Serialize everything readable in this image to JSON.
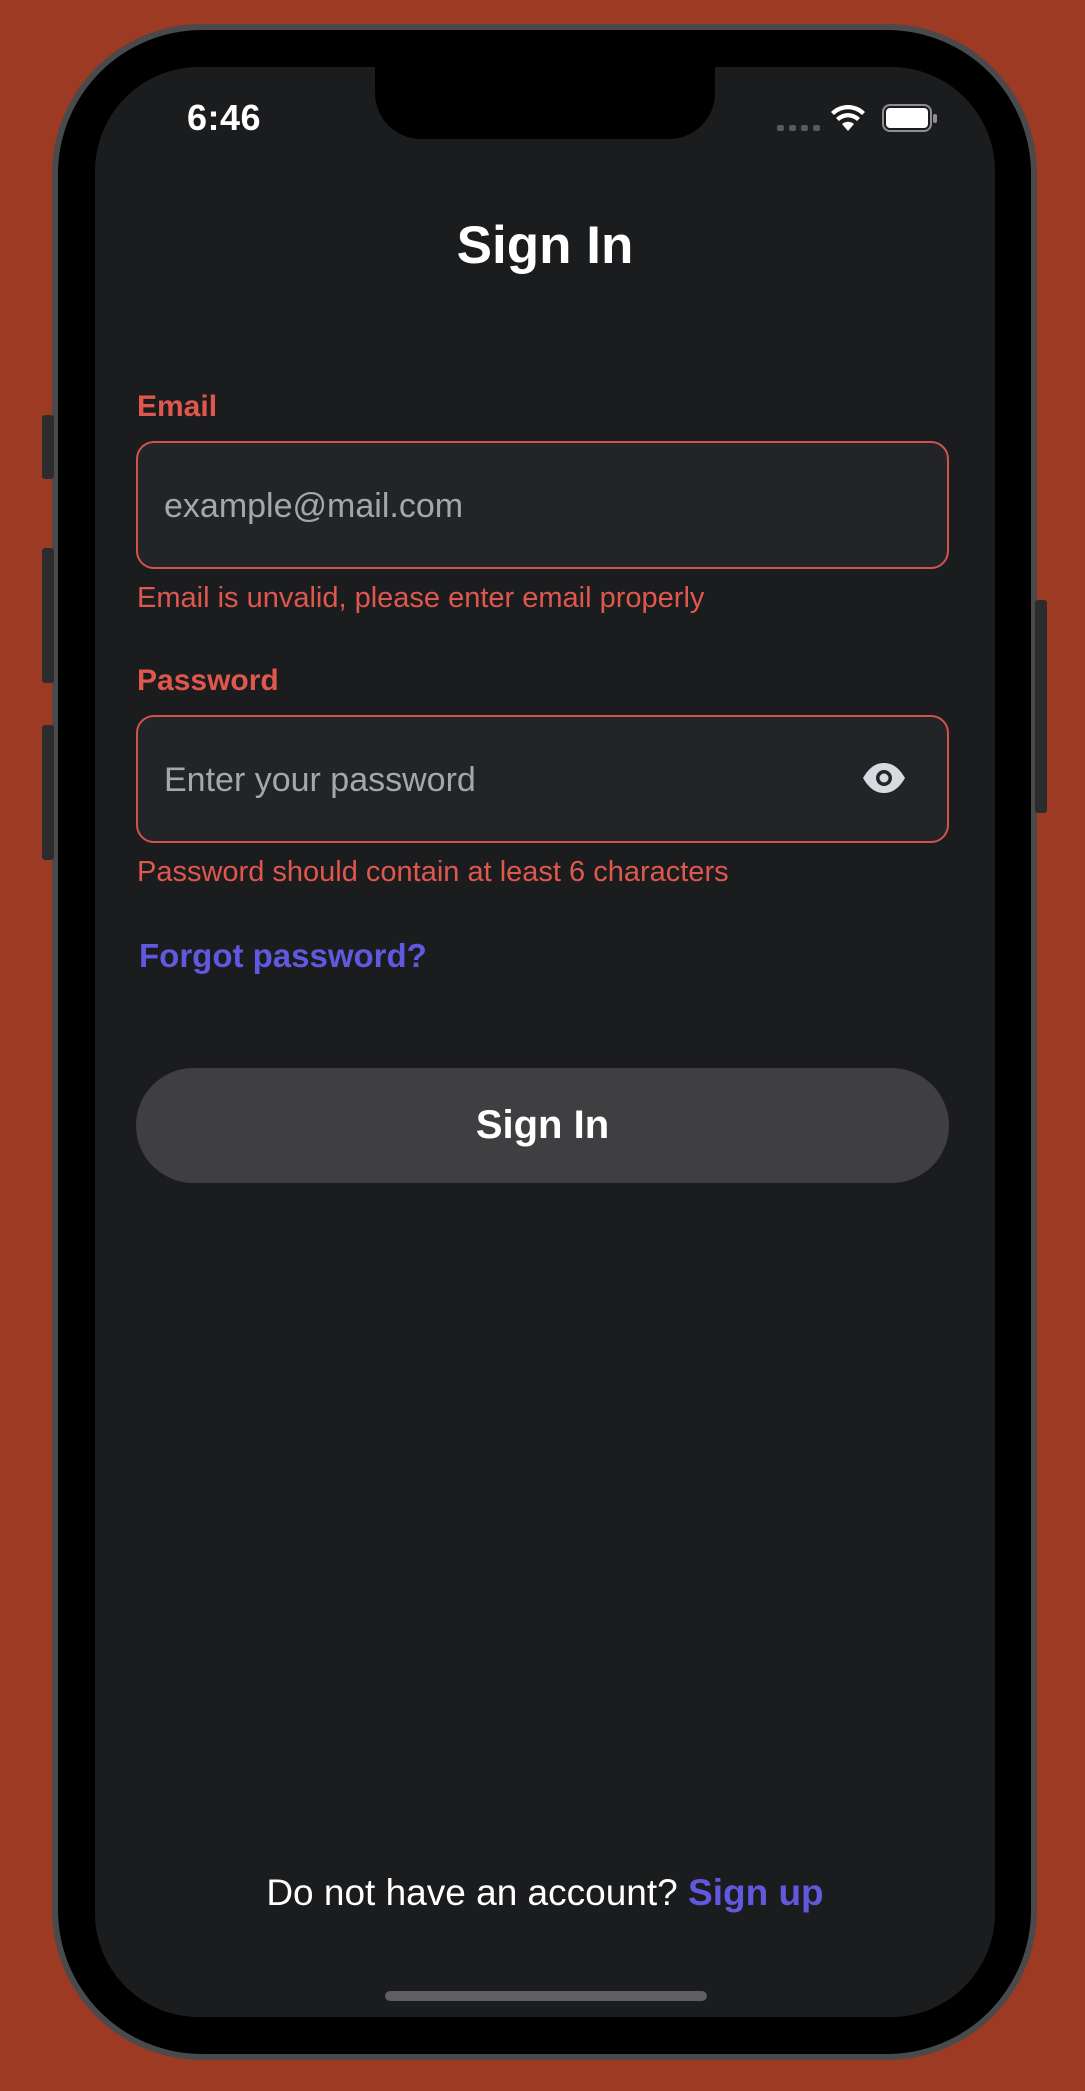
{
  "status_bar": {
    "time": "6:46"
  },
  "header": {
    "title": "Sign In"
  },
  "form": {
    "email": {
      "label": "Email",
      "placeholder": "example@mail.com",
      "value": "",
      "error": "Email is unvalid, please enter email properly"
    },
    "password": {
      "label": "Password",
      "placeholder": "Enter your password",
      "value": "",
      "error": "Password should contain at least 6 characters",
      "toggle_icon": "eye-icon"
    },
    "forgot_label": "Forgot password?",
    "submit_label": "Sign In"
  },
  "footer": {
    "prompt": "Do not have an account?",
    "signup_label": "Sign up"
  },
  "colors": {
    "background": "#9c3a24",
    "screen": "#1b1c1e",
    "error": "#e0574e",
    "accent": "#6158e0",
    "button": "#3f3f42"
  }
}
